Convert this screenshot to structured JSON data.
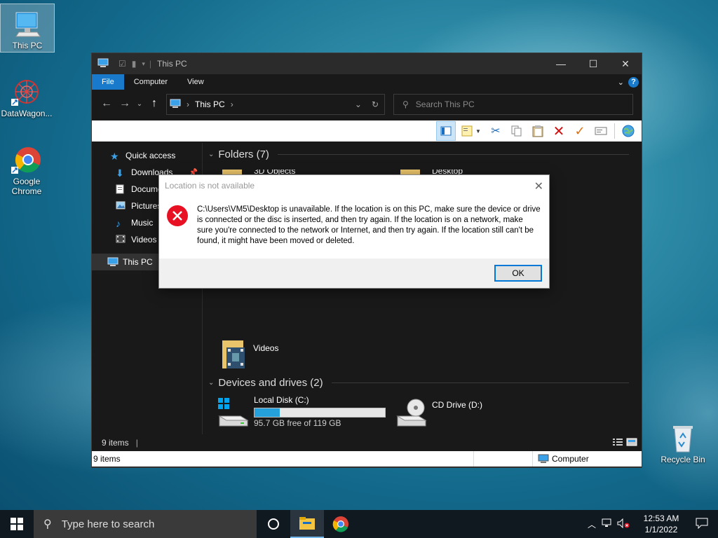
{
  "desktop": {
    "icons": [
      {
        "label": "This PC"
      },
      {
        "label": "DataWagon..."
      },
      {
        "label": "Google Chrome"
      },
      {
        "label": "Recycle Bin"
      }
    ]
  },
  "explorer": {
    "title": "This PC",
    "ribbon_tabs": [
      "File",
      "Computer",
      "View"
    ],
    "address": "This PC",
    "search_placeholder": "Search This PC",
    "nav": {
      "quick_access": "Quick access",
      "items": [
        "Downloads",
        "Documents",
        "Pictures",
        "Music",
        "Videos"
      ],
      "this_pc": "This PC"
    },
    "folders_header": "Folders (7)",
    "folder_partial_1": "3D Objects",
    "folder_partial_2": "Desktop",
    "videos_label": "Videos",
    "devices_header": "Devices and drives (2)",
    "drives": [
      {
        "name": "Local Disk (C:)",
        "free": "95.7 GB free of 119 GB",
        "used_fraction": 0.196
      },
      {
        "name": "CD Drive (D:)"
      }
    ],
    "status_items": "9 items",
    "footer_items": "9 items",
    "footer_location": "Computer"
  },
  "dialog": {
    "title": "Location is not available",
    "message": "C:\\Users\\VM5\\Desktop is unavailable. If the location is on this PC, make sure the device or drive is connected or the disc is inserted, and then try again. If the location is on a network, make sure you're connected to the network or Internet, and then try again. If the location still can't be found, it might have been moved or deleted.",
    "ok_label": "OK"
  },
  "taskbar": {
    "search_placeholder": "Type here to search",
    "time": "12:53 AM",
    "date": "1/1/2022"
  }
}
